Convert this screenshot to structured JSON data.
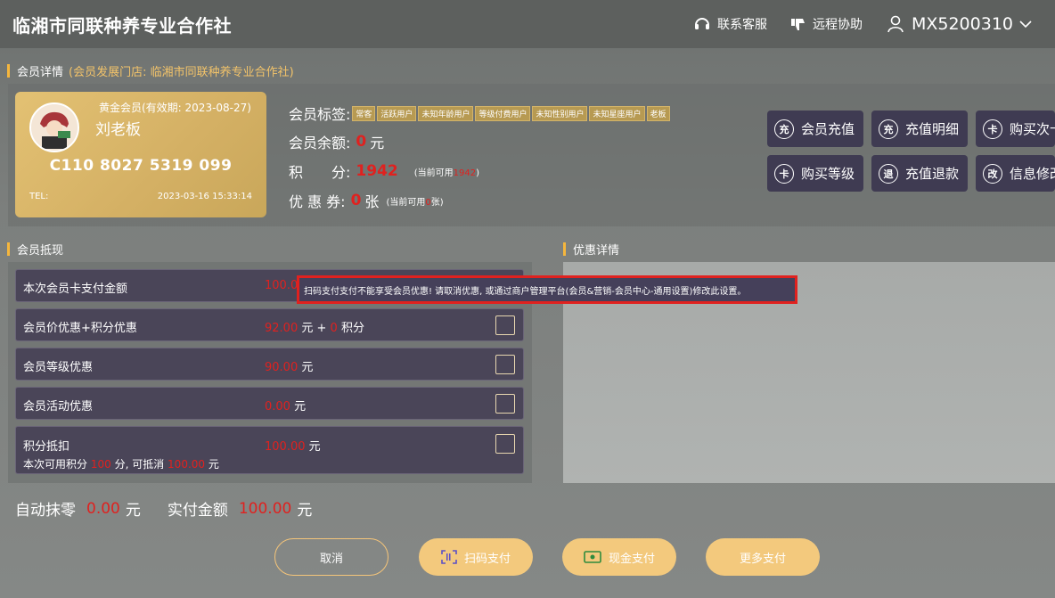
{
  "header": {
    "title": "临湘市同联种养专业合作社",
    "service_label": "联系客服",
    "remote_label": "远程协助",
    "user_label": "MX5200310"
  },
  "member_detail": {
    "section_title": "会员详情",
    "section_sub": "(会员发展门店: 临湘市同联种养专业合作社)"
  },
  "card": {
    "level": "黄金会员(有效期: 2023-08-27)",
    "name": "刘老板",
    "number": "C110 8027 5319 099",
    "tel_label": "TEL:",
    "date": "2023-03-16 15:33:14"
  },
  "info": {
    "tags_label": "会员标签:",
    "tags": [
      "常客",
      "活跃用户",
      "未知年龄用户",
      "等级付费用户",
      "未知性别用户",
      "未知星座用户",
      "老板"
    ],
    "balance_label": "会员余额:",
    "balance_value": "0",
    "balance_unit": "元",
    "points_label": "积　　分:",
    "points_value": "1942",
    "points_avail_prefix": "(当前可用",
    "points_avail_value": "1942",
    "points_avail_suffix": ")",
    "coupon_label": "优 惠 券:",
    "coupon_value": "0",
    "coupon_unit": "张",
    "coupon_avail_prefix": "(当前可用",
    "coupon_avail_value": "0",
    "coupon_avail_suffix": "张)"
  },
  "actions": {
    "recharge": {
      "icon": "充",
      "label": "会员充值"
    },
    "recharge_detail": {
      "icon": "充",
      "label": "充值明细"
    },
    "buy_times": {
      "icon": "卡",
      "label": "购买次卡"
    },
    "buy_level": {
      "icon": "卡",
      "label": "购买等级"
    },
    "refund": {
      "icon": "退",
      "label": "充值退款"
    },
    "edit_info": {
      "icon": "改",
      "label": "信息修改"
    }
  },
  "deduct": {
    "section_title": "会员抵现",
    "rows": [
      {
        "label": "本次会员卡支付金额",
        "value": "100.00"
      },
      {
        "label": "会员价优惠+积分优惠",
        "value": "92.00",
        "unit": "元 +",
        "points": "0",
        "points_unit": "积分"
      },
      {
        "label": "会员等级优惠",
        "value": "90.00",
        "unit": "元"
      },
      {
        "label": "会员活动优惠",
        "value": "0.00",
        "unit": "元"
      },
      {
        "label": "积分抵扣",
        "value": "100.00",
        "unit": "元",
        "sub_prefix": "本次可用积分",
        "sub_points": "100",
        "sub_mid": "分, 可抵消",
        "sub_amount": "100.00",
        "sub_unit": "元"
      }
    ]
  },
  "tooltip": "扫码支付支付不能享受会员优惠! 请取消优惠, 或通过商户管理平台(会员&营销-会员中心-通用设置)修改此设置。",
  "discount": {
    "section_title": "优惠详情"
  },
  "summary": {
    "auto_zero_label": "自动抹零",
    "auto_zero_value": "0.00",
    "unit1": "元",
    "actual_label": "实付金额",
    "actual_value": "100.00",
    "unit2": "元"
  },
  "buttons": {
    "cancel": "取消",
    "scan_pay": "扫码支付",
    "cash_pay": "现金支付",
    "more_pay": "更多支付"
  },
  "colors": {
    "accent_gold": "#f5b63d",
    "red": "#e0211f",
    "dark_button": "#3f3b52",
    "card_gold": "#d4b064",
    "pill_button": "#f3c97d"
  }
}
